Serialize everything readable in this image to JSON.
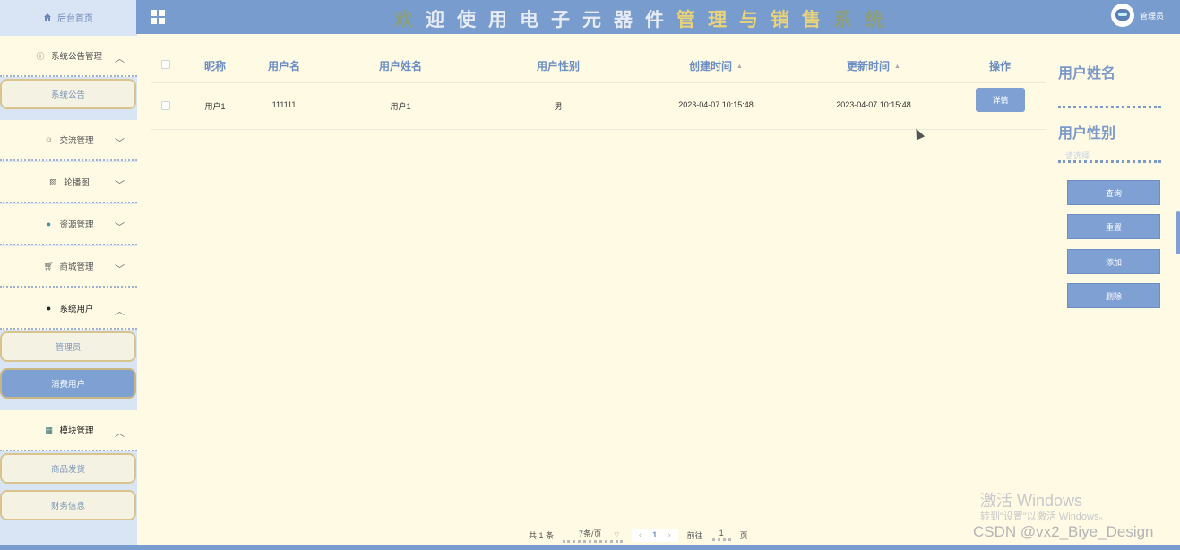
{
  "header": {
    "home_label": "后台首页",
    "title_chars": [
      "欢",
      "迎",
      "使",
      "用",
      "电",
      "子",
      "元",
      "器",
      "件",
      "管",
      "理",
      "与",
      "销",
      "售",
      "系",
      "统"
    ],
    "user_label": "管理员"
  },
  "sidebar": {
    "groups": [
      {
        "label": "系统公告管理",
        "icon": "info-circle-icon"
      },
      {
        "label": "交流管理",
        "icon": "chat-icon"
      },
      {
        "label": "轮播图",
        "icon": "image-icon"
      },
      {
        "label": "资源管理",
        "icon": "pin-icon"
      },
      {
        "label": "商城管理",
        "icon": "cart-icon"
      },
      {
        "label": "系统用户",
        "icon": "user-icon"
      },
      {
        "label": "模块管理",
        "icon": "grid-icon"
      }
    ],
    "items": [
      {
        "label": "系统公告"
      },
      {
        "label": "管理员"
      },
      {
        "label": "消费用户"
      },
      {
        "label": "商品发货"
      },
      {
        "label": "财务信息"
      }
    ]
  },
  "table": {
    "columns": [
      "昵称",
      "用户名",
      "用户姓名",
      "用户性别",
      "创建时间",
      "更新时间",
      "操作"
    ],
    "rows": [
      {
        "nickname": "用户1",
        "username": "111111",
        "realname": "用户1",
        "gender": "男",
        "created": "2023-04-07 10:15:48",
        "updated": "2023-04-07 10:15:48",
        "action": "详情"
      }
    ]
  },
  "search": {
    "name_label": "用户姓名",
    "gender_label": "用户性别",
    "gender_placeholder": "请选择",
    "query_btn": "查询",
    "reset_btn": "重置",
    "add_btn": "添加",
    "delete_btn": "删除"
  },
  "pagination": {
    "total_text": "共 1 条",
    "page_size": "7条/页",
    "current_page": "1",
    "goto_label": "前往",
    "goto_value": "1",
    "page_unit": "页"
  },
  "overlay": {
    "activate_title": "激活 Windows",
    "activate_sub": "转到\"设置\"以激活 Windows。",
    "csdn": "CSDN @vx2_Biye_Design"
  }
}
